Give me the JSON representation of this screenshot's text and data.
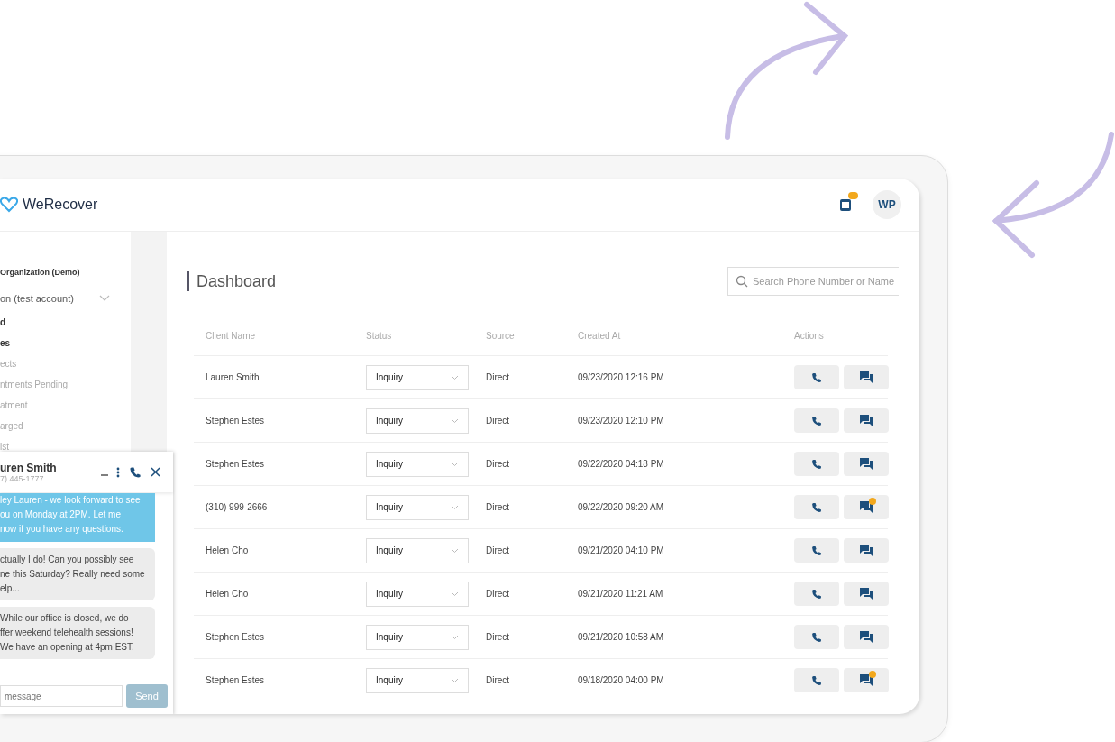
{
  "header": {
    "logo": "WeRecover",
    "avatar": "WP",
    "notification_badge": true
  },
  "sidebar": {
    "organization": "Organization (Demo)",
    "account": "on (test account)",
    "items": [
      {
        "label": "d",
        "kind": "heading"
      },
      {
        "label": "es",
        "kind": "heading"
      },
      {
        "label": "ects",
        "kind": "link"
      },
      {
        "label": "ntments Pending",
        "kind": "link"
      },
      {
        "label": "atment",
        "kind": "link"
      },
      {
        "label": "arged",
        "kind": "link"
      },
      {
        "label": "ist",
        "kind": "link"
      }
    ]
  },
  "chat": {
    "name": "uren Smith",
    "phone": "7) 445-1777",
    "messages": [
      {
        "text": "ley Lauren - we look forward to see\nou on Monday at 2PM. Let me\nnow if you have any questions.",
        "kind": "sent"
      },
      {
        "text": "ctually I do! Can you possibly see\nne this Saturday? Really need some\nelp...",
        "kind": "received"
      },
      {
        "text": "While our office is closed, we do\nffer weekend telehealth sessions!\nWe have an opening at 4pm EST.",
        "kind": "received"
      }
    ],
    "input_placeholder": "message",
    "send": "Send"
  },
  "dashboard": {
    "title": "Dashboard",
    "search_placeholder": "Search Phone Number or Name",
    "columns": [
      "Client Name",
      "Status",
      "Source",
      "Created At",
      "Actions"
    ],
    "rows": [
      {
        "client": "Lauren Smith",
        "status": "Inquiry",
        "source": "Direct",
        "created": "09/23/2020 12:16 PM",
        "unread": false
      },
      {
        "client": "Stephen Estes",
        "status": "Inquiry",
        "source": "Direct",
        "created": "09/23/2020 12:10 PM",
        "unread": false
      },
      {
        "client": "Stephen Estes",
        "status": "Inquiry",
        "source": "Direct",
        "created": "09/22/2020 04:18 PM",
        "unread": false
      },
      {
        "client": "(310) 999-2666",
        "status": "Inquiry",
        "source": "Direct",
        "created": "09/22/2020 09:20 AM",
        "unread": true
      },
      {
        "client": "Helen Cho",
        "status": "Inquiry",
        "source": "Direct",
        "created": "09/21/2020 04:10 PM",
        "unread": false
      },
      {
        "client": "Helen Cho",
        "status": "Inquiry",
        "source": "Direct",
        "created": "09/21/2020 11:21 AM",
        "unread": false
      },
      {
        "client": "Stephen Estes",
        "status": "Inquiry",
        "source": "Direct",
        "created": "09/21/2020 10:58 AM",
        "unread": false
      },
      {
        "client": "Stephen Estes",
        "status": "Inquiry",
        "source": "Direct",
        "created": "09/18/2020 04:00 PM",
        "unread": true
      }
    ]
  }
}
